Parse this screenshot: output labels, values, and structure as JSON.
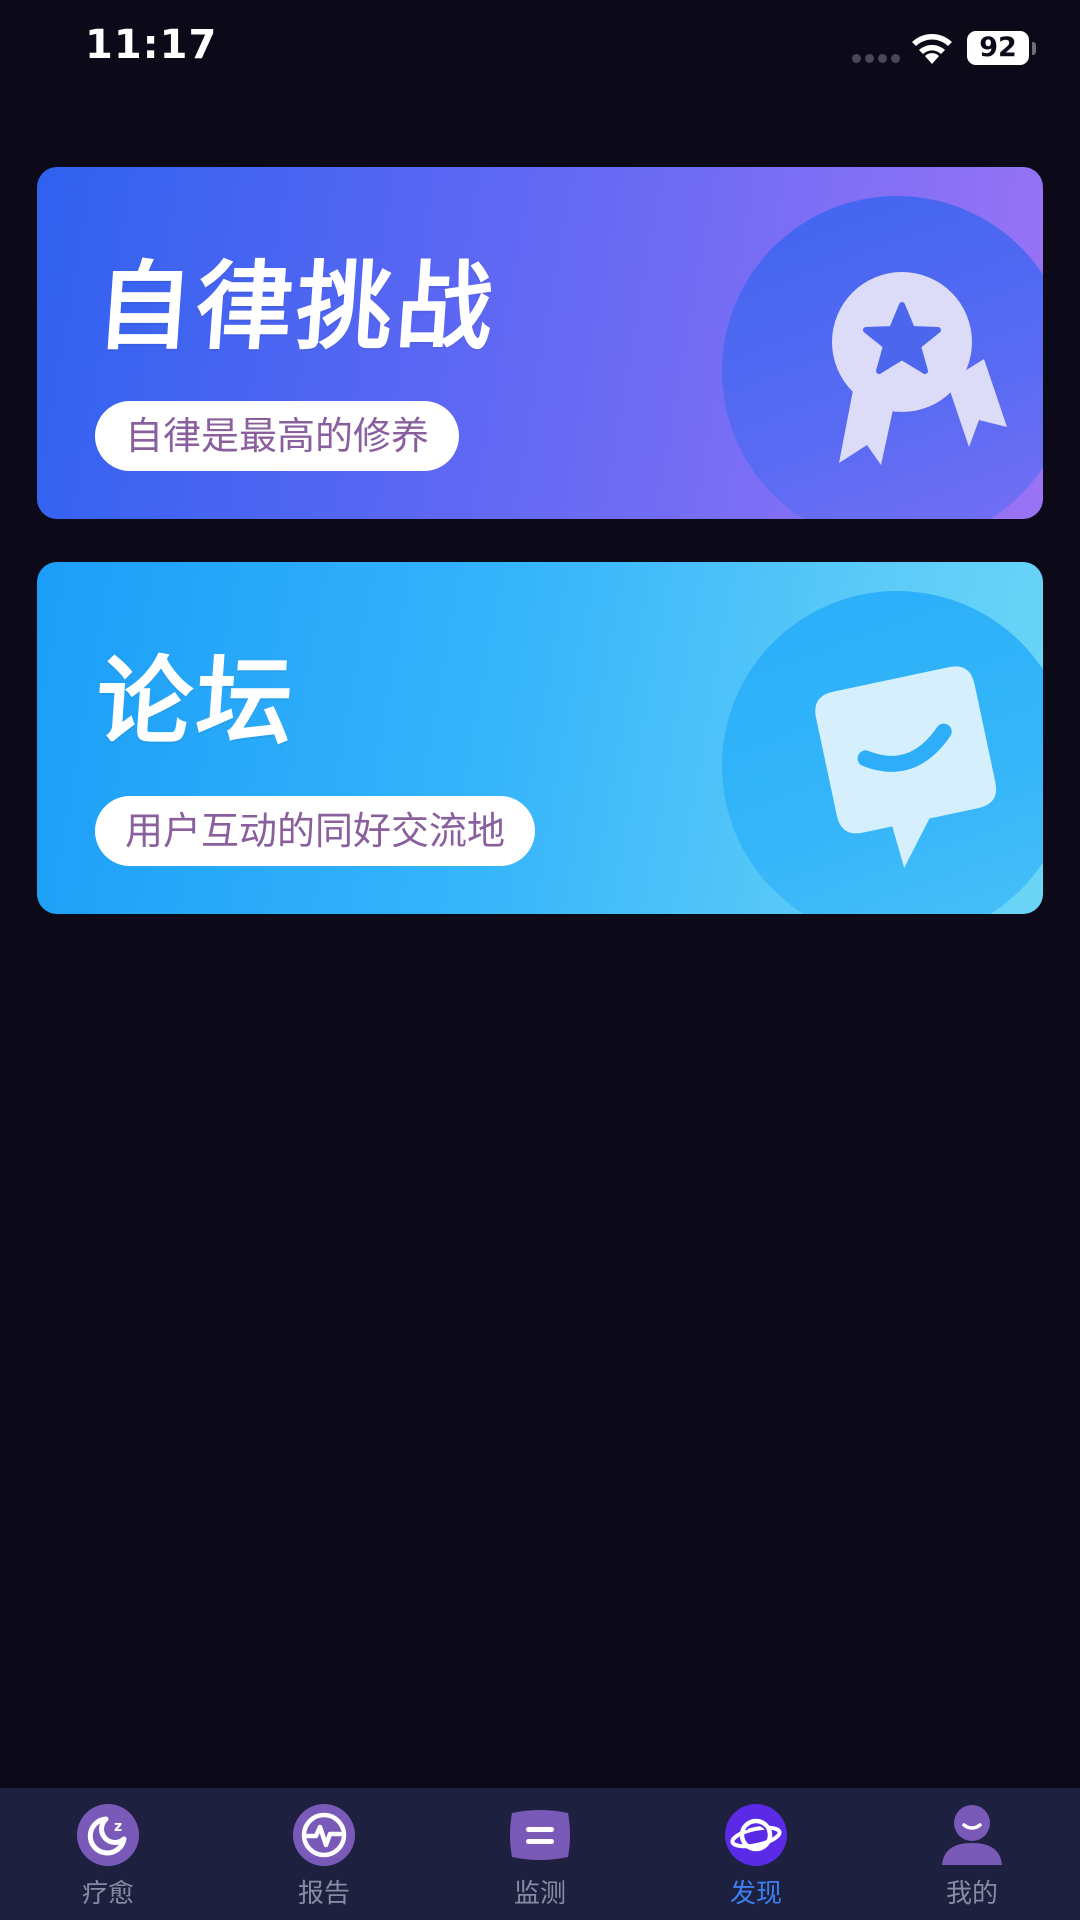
{
  "status_bar": {
    "time": "11:17",
    "battery": "92"
  },
  "cards": [
    {
      "id": "challenge",
      "title": "自律挑战",
      "subtitle": "自律是最高的修养",
      "icon": "award-ribbon-icon"
    },
    {
      "id": "forum",
      "title": "论坛",
      "subtitle": "用户互动的同好交流地",
      "icon": "chat-bubble-icon"
    }
  ],
  "tab_bar": {
    "active": "发现",
    "items": [
      {
        "label": "疗愈",
        "icon": "moon-sleep-icon"
      },
      {
        "label": "报告",
        "icon": "pulse-icon"
      },
      {
        "label": "监测",
        "icon": "pillow-icon"
      },
      {
        "label": "发现",
        "icon": "planet-icon"
      },
      {
        "label": "我的",
        "icon": "user-icon"
      }
    ]
  },
  "colors": {
    "background": "#0c0919",
    "tab_bar": "#1e2040",
    "tab_active": "#3d7ff0",
    "tab_inactive": "#8a8aa2",
    "pill_text": "#8a5f9e"
  }
}
